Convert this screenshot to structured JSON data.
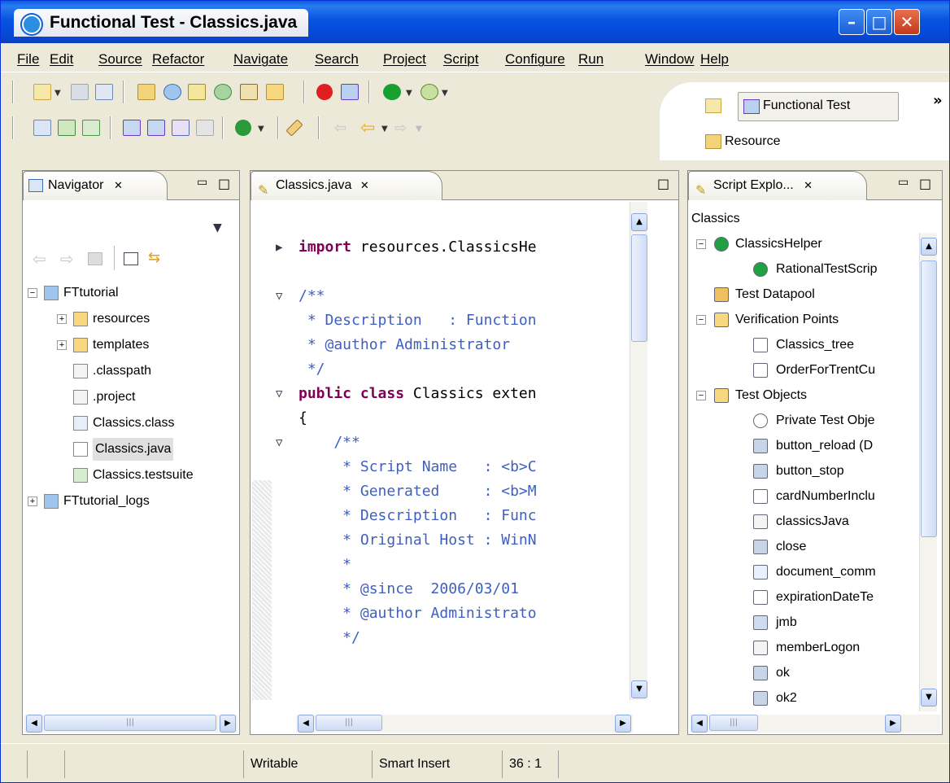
{
  "window": {
    "title": "Functional Test - Classics.java"
  },
  "menu": [
    "File",
    "Edit",
    "Source",
    "Refactor",
    "Navigate",
    "Search",
    "Project",
    "Script",
    "Configure",
    "Run",
    "Window",
    "Help"
  ],
  "perspectives": {
    "functional": "Functional Test",
    "resource": "Resource",
    "more": "»"
  },
  "navigator": {
    "tab": "Navigator",
    "tree": [
      {
        "label": "FTtutorial",
        "toggle": "−",
        "icon": "project-icon"
      },
      {
        "label": "resources",
        "toggle": "+",
        "icon": "folder-icon"
      },
      {
        "label": "templates",
        "toggle": "+",
        "icon": "folder-icon"
      },
      {
        "label": ".classpath",
        "toggle": "",
        "icon": "file-icon"
      },
      {
        "label": ".project",
        "toggle": "",
        "icon": "file-icon"
      },
      {
        "label": "Classics.class",
        "toggle": "",
        "icon": "class-file-icon"
      },
      {
        "label": "Classics.java",
        "toggle": "",
        "icon": "java-file-icon",
        "selected": true
      },
      {
        "label": "Classics.testsuite",
        "toggle": "",
        "icon": "testsuite-icon"
      },
      {
        "label": "FTtutorial_logs",
        "toggle": "+",
        "icon": "project-icon"
      }
    ]
  },
  "editor": {
    "tab": "Classics.java",
    "lines": [
      {
        "text": "",
        "cls": ""
      },
      {
        "text": "import resources.ClassicsHe",
        "cls": "import"
      },
      {
        "text": "",
        "cls": ""
      },
      {
        "text": "/**",
        "cls": "cm"
      },
      {
        "text": " * Description   : Function",
        "cls": "cm"
      },
      {
        "text": " * @author Administrator",
        "cls": "cm"
      },
      {
        "text": " */",
        "cls": "cm"
      },
      {
        "text": "public class Classics exten",
        "cls": "class"
      },
      {
        "text": "{",
        "cls": ""
      },
      {
        "text": "    /**",
        "cls": "cm"
      },
      {
        "text": "     * Script Name   : <b>C",
        "cls": "cm"
      },
      {
        "text": "     * Generated     : <b>M",
        "cls": "cm"
      },
      {
        "text": "     * Description   : Func",
        "cls": "cm"
      },
      {
        "text": "     * Original Host : WinN",
        "cls": "cm"
      },
      {
        "text": "     *",
        "cls": "cm"
      },
      {
        "text": "     * @since  2006/03/01",
        "cls": "cm"
      },
      {
        "text": "     * @author Administrato",
        "cls": "cm"
      },
      {
        "text": "     */",
        "cls": "cm"
      }
    ]
  },
  "script_explorer": {
    "tab": "Script Explo...",
    "root": "Classics",
    "tree": [
      {
        "label": "ClassicsHelper",
        "indent": 0,
        "toggle": "−",
        "icon": "helper-class-icon"
      },
      {
        "label": "RationalTestScrip",
        "indent": 1,
        "toggle": "",
        "icon": "helper-class-icon"
      },
      {
        "label": "Test Datapool",
        "indent": 0,
        "toggle": "",
        "icon": "datapool-icon"
      },
      {
        "label": "Verification Points",
        "indent": 0,
        "toggle": "−",
        "icon": "vp-folder-icon"
      },
      {
        "label": "Classics_tree",
        "indent": 1,
        "toggle": "",
        "icon": "checkbox-icon"
      },
      {
        "label": "OrderForTrentCu",
        "indent": 1,
        "toggle": "",
        "icon": "checkbox-icon"
      },
      {
        "label": "Test Objects",
        "indent": 0,
        "toggle": "−",
        "icon": "test-objects-icon"
      },
      {
        "label": "Private Test Obje",
        "indent": 1,
        "toggle": "",
        "icon": "globe-icon"
      },
      {
        "label": "button_reload (D",
        "indent": 1,
        "toggle": "",
        "icon": "button-object-icon"
      },
      {
        "label": "button_stop",
        "indent": 1,
        "toggle": "",
        "icon": "button-object-icon"
      },
      {
        "label": "cardNumberInclu",
        "indent": 1,
        "toggle": "",
        "icon": "textfield-object-icon"
      },
      {
        "label": "classicsJava",
        "indent": 1,
        "toggle": "",
        "icon": "window-object-icon"
      },
      {
        "label": "close",
        "indent": 1,
        "toggle": "",
        "icon": "button-object-icon"
      },
      {
        "label": "document_comm",
        "indent": 1,
        "toggle": "",
        "icon": "document-object-icon"
      },
      {
        "label": "expirationDateTe",
        "indent": 1,
        "toggle": "",
        "icon": "textfield-object-icon"
      },
      {
        "label": "jmb",
        "indent": 1,
        "toggle": "",
        "icon": "menubar-object-icon"
      },
      {
        "label": "memberLogon",
        "indent": 1,
        "toggle": "",
        "icon": "window-object-icon"
      },
      {
        "label": "ok",
        "indent": 1,
        "toggle": "",
        "icon": "button-object-icon"
      },
      {
        "label": "ok2",
        "indent": 1,
        "toggle": "",
        "icon": "button-object-icon"
      }
    ]
  },
  "status": {
    "mode": "Writable",
    "insert": "Smart Insert",
    "position": "36 : 1"
  }
}
